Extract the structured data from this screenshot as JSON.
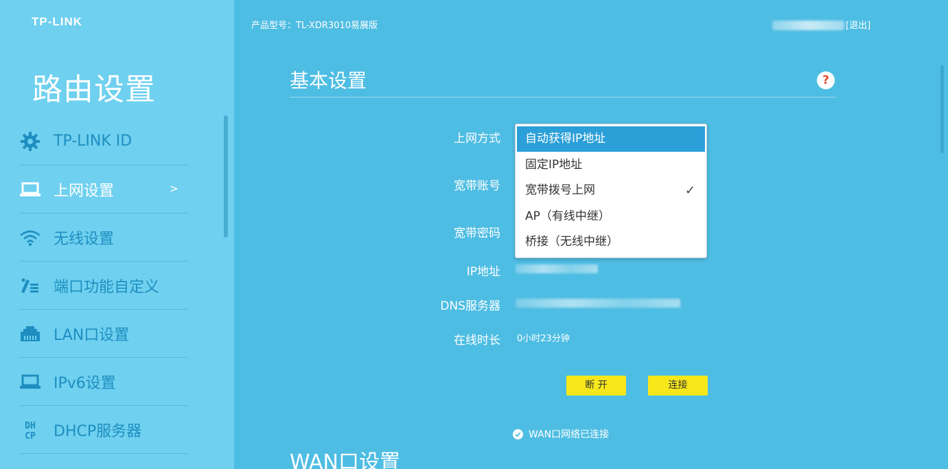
{
  "sidebar": {
    "logo": "TP-LINK",
    "title": "路由设置",
    "items": [
      {
        "label": "TP-LINK ID",
        "icon": "gear-icon"
      },
      {
        "label": "上网设置",
        "icon": "laptop-icon",
        "arrow": ">"
      },
      {
        "label": "无线设置",
        "icon": "wifi-icon"
      },
      {
        "label": "端口功能自定义",
        "icon": "pen-list-icon"
      },
      {
        "label": "LAN口设置",
        "icon": "ethernet-port-icon"
      },
      {
        "label": "IPv6设置",
        "icon": "laptop-icon"
      },
      {
        "label": "DHCP服务器",
        "icon": "dhcp-icon"
      }
    ]
  },
  "header": {
    "model": "产品型号：TL-XDR3010易展版",
    "logout": "[退出]"
  },
  "basic": {
    "title": "基本设置",
    "help": "?",
    "labels": {
      "mode": "上网方式",
      "account": "宽带账号",
      "password": "宽带密码",
      "ip": "IP地址",
      "dns": "DNS服务器",
      "online": "在线时长"
    },
    "online_value": "0小时23分钟",
    "disconnect": "断 开",
    "connect": "连接",
    "status": "WAN口网络已连接"
  },
  "dropdown": {
    "options": [
      "自动获得IP地址",
      "固定IP地址",
      "宽带拨号上网",
      "AP（有线中继）",
      "桥接（无线中继）"
    ],
    "highlighted_index": 0,
    "checked_index": 2,
    "check_mark": "✓"
  },
  "wan": {
    "title": "WAN口设置"
  },
  "colors": {
    "sidebar_bg": "#6fd0ef",
    "main_bg": "#4ebde3",
    "button": "#f6e71b",
    "highlight": "#2b9fd8"
  }
}
